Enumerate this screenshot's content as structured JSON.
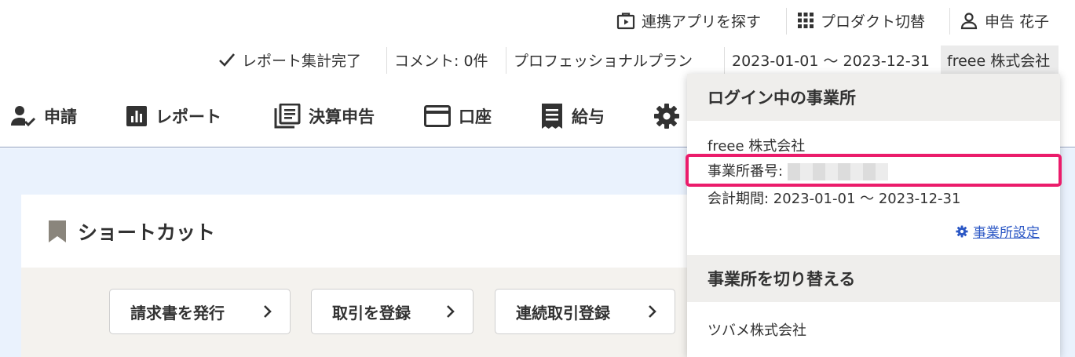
{
  "topbar": {
    "find_apps": "連携アプリを探す",
    "switch_product": "プロダクト切替",
    "user_name": "申告 花子"
  },
  "status": {
    "report_done": "レポート集計完了",
    "comments": "コメント: 0件",
    "plan": "プロフェッショナルプラン",
    "period": "2023-01-01 ～ 2023-12-31",
    "company": "freee 株式会社"
  },
  "nav": {
    "items": [
      {
        "label": "申請",
        "icon": "user-check-icon"
      },
      {
        "label": "レポート",
        "icon": "bar-chart-icon"
      },
      {
        "label": "決算申告",
        "icon": "document-stack-icon"
      },
      {
        "label": "口座",
        "icon": "card-icon"
      },
      {
        "label": "給与",
        "icon": "receipt-icon"
      },
      {
        "label": "",
        "icon": "gear-icon"
      }
    ]
  },
  "shortcut": {
    "title": "ショートカット",
    "buttons": [
      "請求書を発行",
      "取引を登録",
      "連続取引登録"
    ]
  },
  "dropdown": {
    "current_header": "ログイン中の事業所",
    "company_name": "freee 株式会社",
    "office_number_label": "事業所番号:",
    "period_label": "会計期間: 2023-01-01 ～ 2023-12-31",
    "settings_link": "事業所設定",
    "switch_header": "事業所を切り替える",
    "other_company": "ツバメ株式会社"
  },
  "colors": {
    "accent_link": "#2b57c5",
    "highlight": "#eb1c6b",
    "page_bg": "#eaf2fd"
  }
}
